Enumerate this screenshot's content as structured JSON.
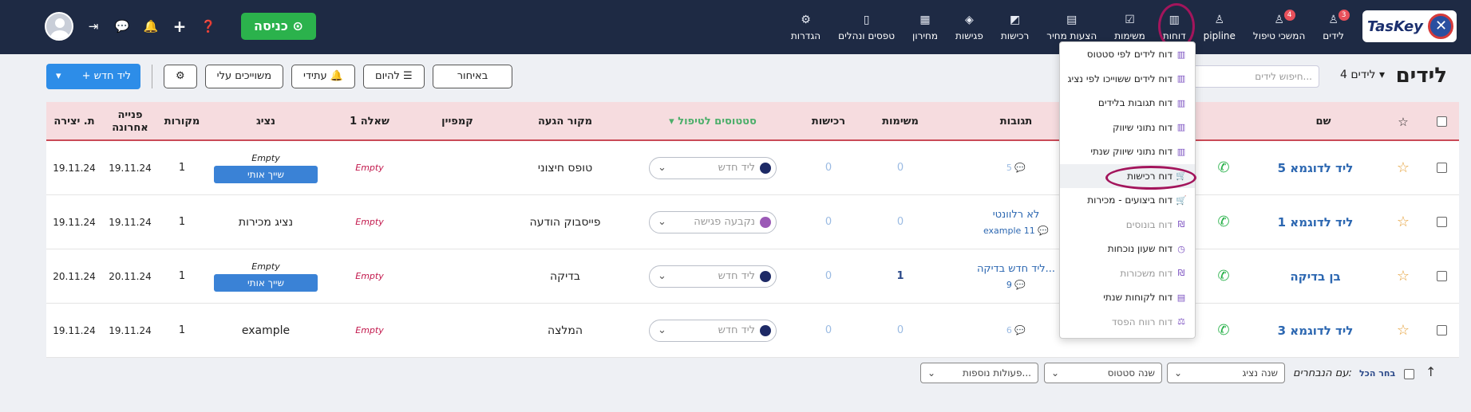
{
  "brand": {
    "logo_text": "TasKey"
  },
  "nav": {
    "items": [
      {
        "key": "leads",
        "label": "לידים",
        "icon": "user-icon",
        "glyph": "♙",
        "badge": "3"
      },
      {
        "key": "ongoing",
        "label": "המשכי טיפול",
        "icon": "user-icon",
        "glyph": "♙",
        "badge": "4"
      },
      {
        "key": "pipline",
        "label": "pipline",
        "icon": "user-icon",
        "glyph": "♙",
        "badge": ""
      },
      {
        "key": "reports",
        "label": "דוחות",
        "icon": "bar-chart-icon",
        "glyph": "▥",
        "badge": ""
      },
      {
        "key": "tasks",
        "label": "משימות",
        "icon": "checkbox-icon",
        "glyph": "☑",
        "badge": ""
      },
      {
        "key": "quotes",
        "label": "הצעות מחיר",
        "icon": "document-icon",
        "glyph": "▤",
        "badge": ""
      },
      {
        "key": "purchases",
        "label": "רכישות",
        "icon": "chart-up-icon",
        "glyph": "◩",
        "badge": ""
      },
      {
        "key": "meetings",
        "label": "פגישות",
        "icon": "handshake-icon",
        "glyph": "◈",
        "badge": ""
      },
      {
        "key": "pricelist",
        "label": "מחירון",
        "icon": "barcode-icon",
        "glyph": "▦",
        "badge": ""
      },
      {
        "key": "forms",
        "label": "טפסים ונהלים",
        "icon": "book-icon",
        "glyph": "▯",
        "badge": ""
      },
      {
        "key": "settings",
        "label": "הגדרות",
        "icon": "gear-icon",
        "glyph": "⚙",
        "badge": ""
      }
    ]
  },
  "topbar": {
    "checkin_label": "כניסה ⊙"
  },
  "page": {
    "title": "לידים",
    "count_label": "4 לידים ▾",
    "search_placeholder": "חיפוש לידים..."
  },
  "actions": {
    "new_lead": "+ ליד חדש",
    "assigned": "משוייכים עלי",
    "future": "עתידי 🔔",
    "today": "להיום ☰",
    "late": "באיחור",
    "settings_glyph": "⚙"
  },
  "table": {
    "headers": {
      "name": "שם",
      "tags": "תגובות",
      "tasks": "משימות",
      "purchases": "רכישות",
      "status": "▾ סטטוסים לטיפול",
      "source": "מקור הגעה",
      "campaign": "קמפיין",
      "question1": "שאלה 1",
      "agent": "נציג",
      "sources": "מקורות",
      "last_contact": "פנייה אחרונה",
      "created": "ת. יצירה"
    },
    "rows": [
      {
        "name": "ליד לדוגמא 5",
        "tag_main": "",
        "tag_sub": "5 💬",
        "tasks": "0",
        "purchases": "0",
        "status": "ליד חדש",
        "status_color": "#1e2a66",
        "source": "טופס חיצוני",
        "question1": "Empty",
        "agent_text": "Empty",
        "agent_button": "שייך אותי",
        "sources": "1",
        "last_contact": "19.11.24",
        "created": "19.11.24"
      },
      {
        "name": "ליד לדוגמא 1",
        "tag_main": "לא רלוונטי",
        "tag_sub": "example 11 💬",
        "tasks": "0",
        "purchases": "0",
        "status": "נקבעה פגישה",
        "status_color": "#9b59b6",
        "source": "פייסבוק הודעה",
        "question1": "Empty",
        "agent_text": "נציג מכירות",
        "agent_button": "",
        "sources": "1",
        "last_contact": "19.11.24",
        "created": "19.11.24"
      },
      {
        "name": "בן בדיקה",
        "tag_main": "ליד חדש בדיקה...",
        "tag_sub": "9 💬",
        "tasks": "1",
        "purchases": "0",
        "status": "ליד חדש",
        "status_color": "#1e2a66",
        "source": "בדיקה",
        "question1": "Empty",
        "agent_text": "Empty",
        "agent_button": "שייך אותי",
        "sources": "1",
        "last_contact": "20.11.24",
        "created": "20.11.24"
      },
      {
        "name": "ליד לדוגמא 3",
        "tag_main": "",
        "tag_sub": "6 💬",
        "tasks": "0",
        "purchases": "0",
        "status": "ליד חדש",
        "status_color": "#1e2a66",
        "source": "המלצה",
        "question1": "Empty",
        "agent_text": "example",
        "agent_button": "",
        "sources": "1",
        "last_contact": "19.11.24",
        "created": "19.11.24"
      }
    ]
  },
  "bottom": {
    "select_all": "בחר הכל",
    "with_selected": "עם הנבחרים:",
    "change_agent": "שנה נציג",
    "change_status": "שנה סטטוס",
    "more_actions": "פעולות נוספות..."
  },
  "reports_menu": {
    "items": [
      {
        "label": "דוח לידים לפי סטטוס",
        "icon": "bar-chart-icon",
        "glyph": "▥",
        "dim": false
      },
      {
        "label": "דוח לידים ששוייכו לפי נציג",
        "icon": "bar-chart-icon",
        "glyph": "▥",
        "dim": false
      },
      {
        "label": "דוח תגובות בלידים",
        "icon": "bar-chart-icon",
        "glyph": "▥",
        "dim": false
      },
      {
        "label": "דוח נתוני שיווק",
        "icon": "bar-chart-icon",
        "glyph": "▥",
        "dim": false
      },
      {
        "label": "דוח נתוני שיווק שנתי",
        "icon": "bar-chart-icon",
        "glyph": "▥",
        "dim": false
      },
      {
        "label": "דוח רכישות",
        "icon": "cart-icon",
        "glyph": "🛒",
        "dim": false
      },
      {
        "label": "דוח ביצועים - מכירות",
        "icon": "cart-icon",
        "glyph": "🛒",
        "dim": false
      },
      {
        "label": "דוח בונוסים",
        "icon": "money-icon",
        "glyph": "₪",
        "dim": true
      },
      {
        "label": "דוח שעון נוכחות",
        "icon": "clock-icon",
        "glyph": "◷",
        "dim": false
      },
      {
        "label": "דוח משכורות",
        "icon": "money-icon",
        "glyph": "₪",
        "dim": true
      },
      {
        "label": "דוח לקוחות שנתי",
        "icon": "document-icon",
        "glyph": "▤",
        "dim": false
      },
      {
        "label": "דוח רווח הפסד",
        "icon": "scale-icon",
        "glyph": "⚖",
        "dim": true
      }
    ]
  }
}
